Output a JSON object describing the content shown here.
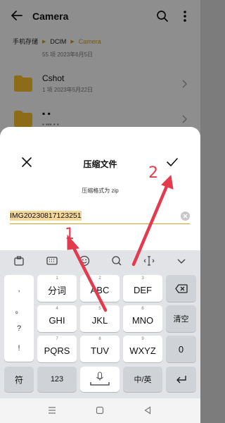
{
  "appbar": {
    "title": "Camera"
  },
  "breadcrumb": [
    "手机存储",
    "DCIM",
    "Camera"
  ],
  "files": [
    {
      "name": "",
      "sub": "55 项   2023年6月5日"
    },
    {
      "name": "Cshot",
      "sub": "1 项   2023年5月22日"
    },
    {
      "name": "▪ ▪",
      "sub": "▪   ▪▪▪   ▪ ▪"
    }
  ],
  "dialog": {
    "title": "压缩文件",
    "format_label": "压缩格式为 zip",
    "filename_value": "IMG20230817123251"
  },
  "keyboard": {
    "side_symbols": [
      ",",
      "。",
      "?",
      "!"
    ],
    "keys": [
      {
        "num": "1",
        "label": "分词"
      },
      {
        "num": "2",
        "label": "ABC"
      },
      {
        "num": "3",
        "label": "DEF"
      },
      {
        "num": "4",
        "label": "GHI"
      },
      {
        "num": "5",
        "label": "JKL"
      },
      {
        "num": "6",
        "label": "MNO"
      },
      {
        "num": "7",
        "label": "PQRS"
      },
      {
        "num": "8",
        "label": "TUV"
      },
      {
        "num": "9",
        "label": "WXYZ"
      }
    ],
    "clear_label": "清空",
    "zero_label": "0",
    "symbol_label": "符",
    "num_label": "123",
    "lang_label": "中/英"
  },
  "annotations": {
    "label_1": "1",
    "label_2": "2",
    "arrow_color": "#e33a4e"
  }
}
